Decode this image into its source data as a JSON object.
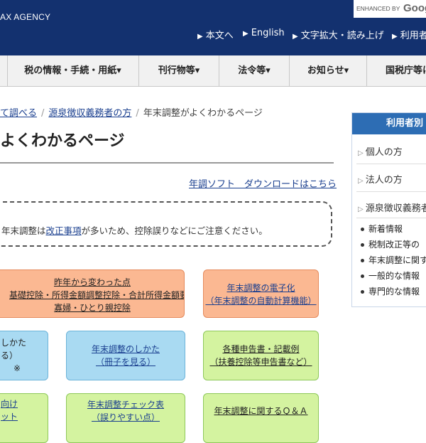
{
  "header": {
    "agency": "AX AGENCY",
    "google_enhanced": "ENHANCED BY",
    "google_word": "Google",
    "util_links": [
      "本文へ",
      "English",
      "文字拡大・読み上げ",
      "利用者"
    ]
  },
  "nav": {
    "items": [
      "税の情報・手続・用紙▾",
      "刊行物等▾",
      "法令等▾",
      "お知らせ▾",
      "国税庁等に"
    ]
  },
  "breadcrumb": {
    "items": [
      "て調べる",
      "源泉徴収義務者の方",
      "年末調整がよくわかるページ"
    ]
  },
  "page_title": "よくわかるページ",
  "download_link": "年調ソフト　ダウンロードはこちら",
  "notice": {
    "pre": "年末調整は",
    "link": "改正事項",
    "post": "が多いため、控除誤りなどにご注意ください。"
  },
  "cards": {
    "changes": [
      "昨年から変わった点",
      "基礎控除・所得金額調整控除・合計所得金額要件",
      "寡婦・ひとり親控除"
    ],
    "electronic": [
      "年末調整の電子化",
      "（年末調整の自動計算機能）"
    ],
    "how_left": [
      "しかた",
      "る）",
      "※"
    ],
    "how_book": [
      "年末調整のしかた",
      "（冊子を見る）"
    ],
    "forms": [
      "各種申告書・記載例",
      "（扶養控除等申告書など）"
    ],
    "for_left": [
      "向け",
      "ット"
    ],
    "checklist": [
      "年末調整チェック表",
      "（誤りやすい点）"
    ],
    "qa": [
      "年末調整に関するＱ＆Ａ"
    ]
  },
  "sidebar": {
    "heading": "利用者別",
    "items": [
      "個人の方",
      "法人の方",
      "源泉徴収義務者"
    ],
    "bullets": [
      "新着情報",
      "税制改正等の",
      "年末調整に関す",
      "一般的な情報",
      "専門的な情報"
    ]
  }
}
